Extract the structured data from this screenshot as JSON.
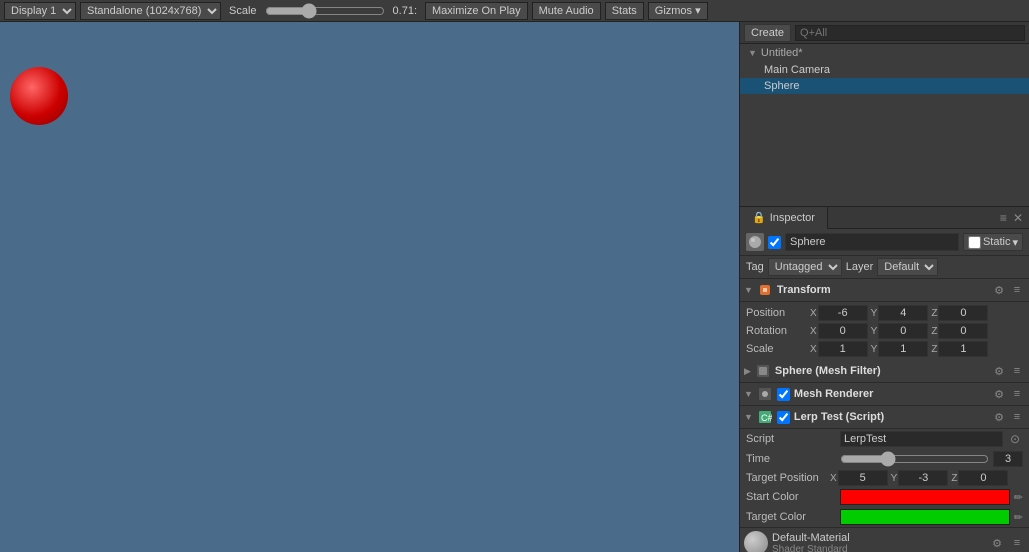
{
  "toolbar": {
    "display_label": "Display 1",
    "resolution_label": "Standalone (1024x768)",
    "scale_label": "Scale",
    "scale_value": "0.71:",
    "maximize_label": "Maximize On Play",
    "mute_label": "Mute Audio",
    "stats_label": "Stats",
    "gizmos_label": "Gizmos"
  },
  "hierarchy": {
    "create_label": "Create",
    "search_placeholder": "Q+All",
    "scene_name": "Untitled*",
    "items": [
      {
        "label": "Main Camera",
        "selected": false
      },
      {
        "label": "Sphere",
        "selected": true
      }
    ]
  },
  "inspector": {
    "tab_label": "Inspector",
    "object_name": "Sphere",
    "static_label": "Static",
    "tag_label": "Tag",
    "tag_value": "Untagged",
    "layer_label": "Layer",
    "layer_value": "Default",
    "transform": {
      "title": "Transform",
      "position_label": "Position",
      "pos_x": "-6",
      "pos_y": "4",
      "pos_z": "0",
      "rotation_label": "Rotation",
      "rot_x": "0",
      "rot_y": "0",
      "rot_z": "0",
      "scale_label": "Scale",
      "scale_x": "1",
      "scale_y": "1",
      "scale_z": "1"
    },
    "mesh_filter": {
      "title": "Sphere (Mesh Filter)"
    },
    "mesh_renderer": {
      "title": "Mesh Renderer"
    },
    "lerp_script": {
      "title": "Lerp Test (Script)",
      "script_label": "Script",
      "script_value": "LerpTest",
      "time_label": "Time",
      "time_value": "3",
      "target_pos_label": "Target Position",
      "tp_x": "5",
      "tp_y": "-3",
      "tp_z": "0",
      "start_color_label": "Start Color",
      "start_color": "#ff0000",
      "target_color_label": "Target Color",
      "target_color": "#00cc00"
    },
    "material": {
      "name": "Default-Material",
      "shader_label": "Shader",
      "shader_value": "Standard"
    }
  }
}
